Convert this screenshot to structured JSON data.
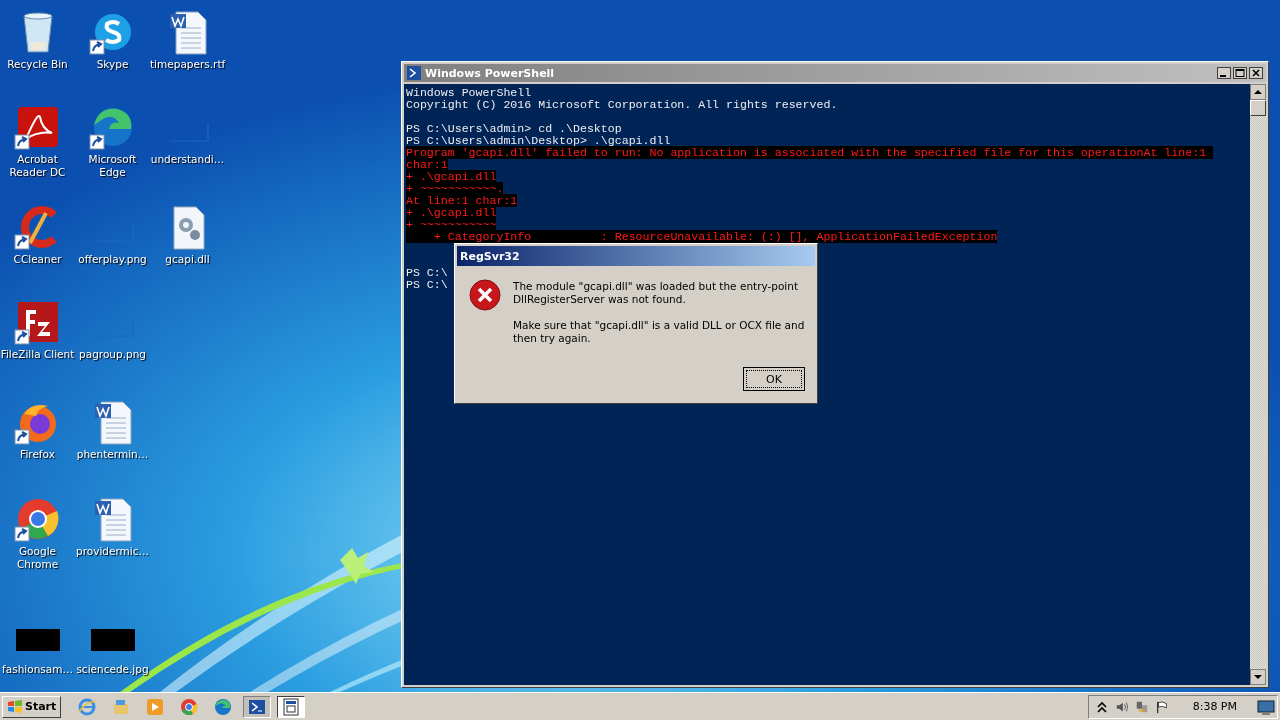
{
  "desktop_icons": [
    {
      "label": "Recycle Bin",
      "kind": "recycle",
      "shortcut": false
    },
    {
      "label": "Acrobat Reader DC",
      "kind": "acrobat",
      "shortcut": true
    },
    {
      "label": "CCleaner",
      "kind": "ccleaner",
      "shortcut": true
    },
    {
      "label": "FileZilla Client",
      "kind": "filezilla",
      "shortcut": true
    },
    {
      "label": "Firefox",
      "kind": "firefox",
      "shortcut": true
    },
    {
      "label": "Google Chrome",
      "kind": "chrome",
      "shortcut": true
    },
    {
      "label": "fashionsam…",
      "kind": "dark-thumb",
      "shortcut": false
    },
    {
      "label": "Skype",
      "kind": "skype",
      "shortcut": true
    },
    {
      "label": "Microsoft Edge",
      "kind": "edge",
      "shortcut": true
    },
    {
      "label": "offerplay.png",
      "kind": "blank-thumb",
      "shortcut": false
    },
    {
      "label": "pagroup.png",
      "kind": "blank-thumb",
      "shortcut": false
    },
    {
      "label": "phentermin…",
      "kind": "word",
      "shortcut": false
    },
    {
      "label": "providermic…",
      "kind": "word",
      "shortcut": false
    },
    {
      "label": "sciencede.jpg",
      "kind": "dark-thumb",
      "shortcut": false
    },
    {
      "label": "timepapers.rtf",
      "kind": "word",
      "shortcut": false
    },
    {
      "label": "understandi…",
      "kind": "blank-thumb",
      "shortcut": false
    },
    {
      "label": "gcapi.dll",
      "kind": "dll",
      "shortcut": false
    }
  ],
  "console_window": {
    "title": "Windows PowerShell",
    "lines": [
      {
        "kind": "output",
        "text": "Windows PowerShell"
      },
      {
        "kind": "output",
        "text": "Copyright (C) 2016 Microsoft Corporation. All rights reserved."
      },
      {
        "kind": "blank"
      },
      {
        "kind": "output",
        "text": "PS C:\\Users\\admin> cd .\\Desktop"
      },
      {
        "kind": "output",
        "text": "PS C:\\Users\\admin\\Desktop> .\\gcapi.dll"
      },
      {
        "kind": "error",
        "text": "Program 'gcapi.dll' failed to run: No application is associated with the specified file for this operationAt line:1 "
      },
      {
        "kind": "error",
        "text": "char:1"
      },
      {
        "kind": "error",
        "text": "+ .\\gcapi.dll"
      },
      {
        "kind": "error",
        "text": "+ ~~~~~~~~~~~."
      },
      {
        "kind": "error",
        "text": "At line:1 char:1"
      },
      {
        "kind": "error",
        "text": "+ .\\gcapi.dll"
      },
      {
        "kind": "error",
        "text": "+ ~~~~~~~~~~~"
      },
      {
        "kind": "error",
        "text": "    + CategoryInfo          : ResourceUnavailable: (:) [], ApplicationFailedException"
      },
      {
        "kind": "blank"
      },
      {
        "kind": "blank"
      },
      {
        "kind": "output",
        "text": "PS C:\\"
      },
      {
        "kind": "output",
        "text": "PS C:\\"
      }
    ]
  },
  "dialog": {
    "title": "RegSvr32",
    "paragraphs": [
      "The module \"gcapi.dll\" was loaded but the entry-point DllRegisterServer was not found.",
      "Make sure that \"gcapi.dll\" is a valid DLL or OCX file and then try again."
    ],
    "button": "OK"
  },
  "taskbar": {
    "start_label": "Start",
    "items": [
      {
        "kind": "ie",
        "open": false,
        "selected": false
      },
      {
        "kind": "explorer",
        "open": false,
        "selected": false
      },
      {
        "kind": "media",
        "open": false,
        "selected": false
      },
      {
        "kind": "chrome",
        "open": false,
        "selected": false
      },
      {
        "kind": "edge",
        "open": false,
        "selected": false
      },
      {
        "kind": "powershell",
        "open": true,
        "selected": false
      },
      {
        "kind": "regsvr",
        "open": true,
        "selected": true
      }
    ],
    "clock": "8:38 PM"
  }
}
